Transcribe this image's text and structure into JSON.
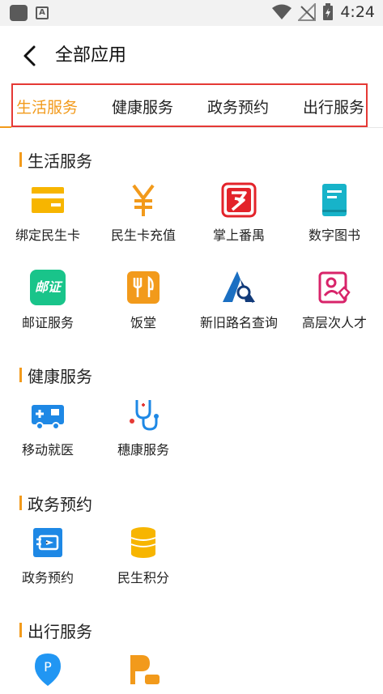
{
  "status_bar": {
    "time": "4:24"
  },
  "header": {
    "title": "全部应用"
  },
  "tabs": [
    {
      "label": "生活服务",
      "active": true
    },
    {
      "label": "健康服务",
      "active": false
    },
    {
      "label": "政务预约",
      "active": false
    },
    {
      "label": "出行服务",
      "active": false
    }
  ],
  "sections": {
    "life": {
      "title": "生活服务",
      "apps": [
        {
          "label": "绑定民生卡",
          "icon": "card-icon"
        },
        {
          "label": "民生卡充值",
          "icon": "yuan-icon"
        },
        {
          "label": "掌上番禺",
          "icon": "panyu-logo-icon"
        },
        {
          "label": "数字图书",
          "icon": "book-icon"
        },
        {
          "label": "邮证服务",
          "icon": "postal-icon",
          "icon_text": "邮证"
        },
        {
          "label": "饭堂",
          "icon": "dining-icon"
        },
        {
          "label": "新旧路名查询",
          "icon": "road-search-icon"
        },
        {
          "label": "高层次人才",
          "icon": "talent-icon"
        }
      ]
    },
    "health": {
      "title": "健康服务",
      "apps": [
        {
          "label": "移动就医",
          "icon": "ambulance-icon"
        },
        {
          "label": "穗康服务",
          "icon": "stethoscope-icon"
        }
      ]
    },
    "gov": {
      "title": "政务预约",
      "apps": [
        {
          "label": "政务预约",
          "icon": "gov-appointment-icon"
        },
        {
          "label": "民生积分",
          "icon": "coins-icon"
        }
      ]
    },
    "travel": {
      "title": "出行服务",
      "apps": [
        {
          "label": "",
          "icon": "parking-pin-icon"
        },
        {
          "label": "",
          "icon": "parking-car-icon"
        }
      ]
    }
  },
  "colors": {
    "accent": "#f29a1b",
    "highlight_border": "#e53935"
  }
}
